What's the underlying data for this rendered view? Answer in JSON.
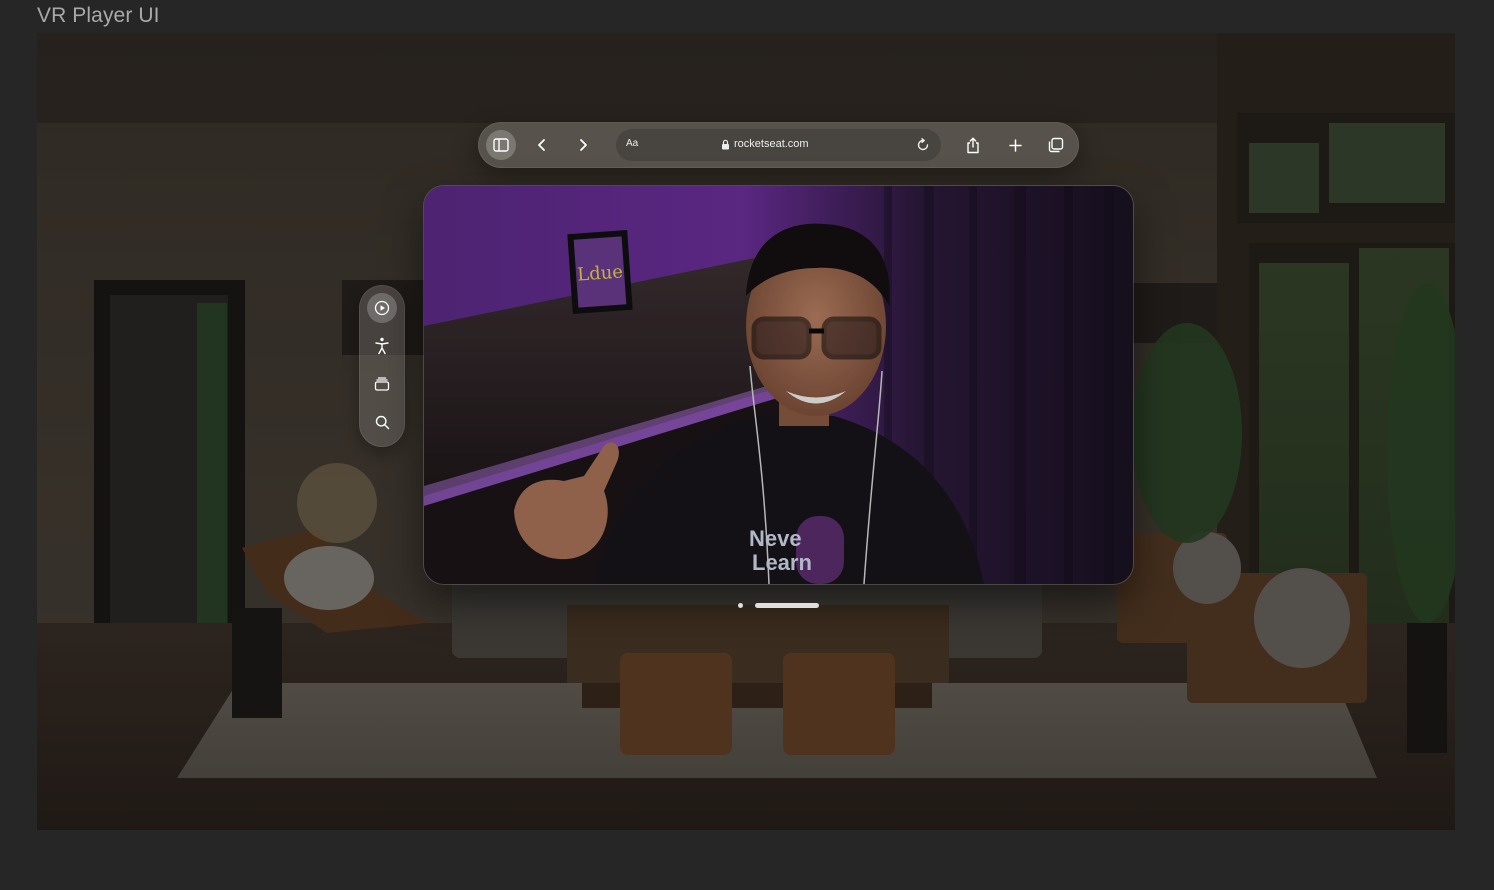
{
  "frame": {
    "title": "VR Player UI"
  },
  "toolbar": {
    "sidebar_icon": "sidebar-icon",
    "back_icon": "chevron-left-icon",
    "forward_icon": "chevron-right-icon",
    "reader_label": "Aa",
    "url": "rocketseat.com",
    "lock_icon": "lock-icon",
    "reload_icon": "reload-icon",
    "share_icon": "share-icon",
    "new_tab_icon": "plus-icon",
    "tabs_icon": "tabs-icon"
  },
  "ornament": {
    "items": [
      {
        "icon": "play-icon",
        "active": true
      },
      {
        "icon": "accessibility-icon",
        "active": false
      },
      {
        "icon": "stack-icon",
        "active": false
      },
      {
        "icon": "search-icon",
        "active": false
      }
    ]
  },
  "video": {
    "hoodie_text_line1": "Neve",
    "hoodie_text_line2": "Learn",
    "frame_sign": "Ldue"
  },
  "colors": {
    "background": "#262626",
    "glass": "#78736e",
    "accent_purple": "#6a2a9a"
  }
}
